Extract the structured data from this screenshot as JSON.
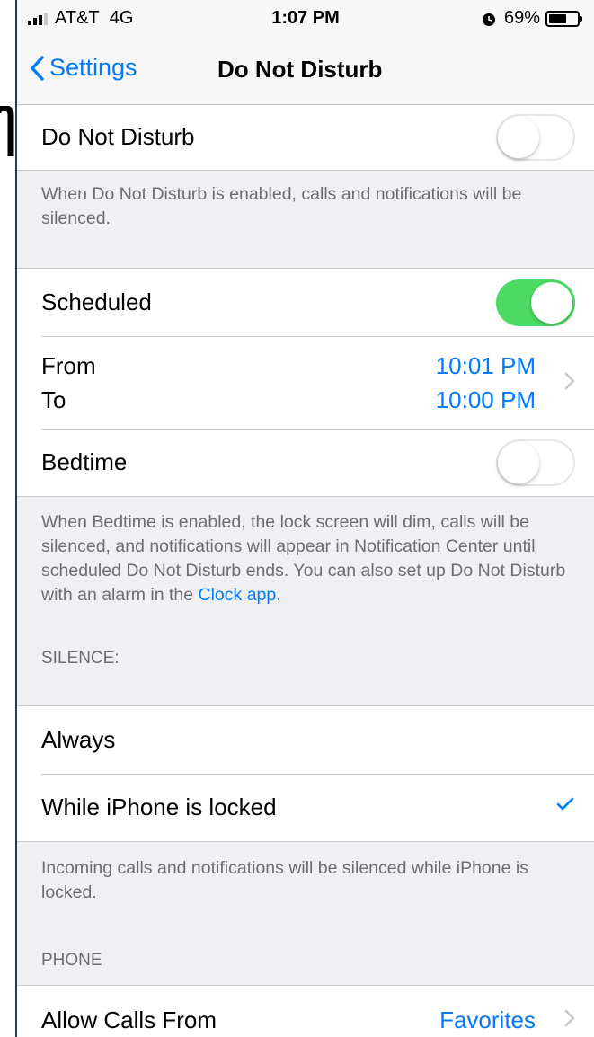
{
  "status": {
    "carrier": "AT&T",
    "network": "4G",
    "time": "1:07 PM",
    "battery": "69%",
    "battery_level": 0.69,
    "alarm_icon": "alarm-clock-icon"
  },
  "nav": {
    "back_label": "Settings",
    "title": "Do Not Disturb"
  },
  "dnd": {
    "label": "Do Not Disturb",
    "enabled": false,
    "footer": "When Do Not Disturb is enabled, calls and notifications will be silenced."
  },
  "scheduled": {
    "label": "Scheduled",
    "enabled": true,
    "from_label": "From",
    "from_value": "10:01 PM",
    "to_label": "To",
    "to_value": "10:00 PM",
    "bedtime_label": "Bedtime",
    "bedtime_enabled": false,
    "footer": "When Bedtime is enabled, the lock screen will dim, calls will be silenced, and notifications will appear in Notification Center until scheduled Do Not Disturb ends. You can also set up Do Not Disturb with an alarm in the",
    "footer_link": "Clock app."
  },
  "silence": {
    "header": "SILENCE:",
    "options": [
      {
        "label": "Always",
        "selected": false
      },
      {
        "label": "While iPhone is locked",
        "selected": true
      }
    ],
    "footer": "Incoming calls and notifications will be silenced while iPhone is locked."
  },
  "phone": {
    "header": "PHONE",
    "allow_calls_label": "Allow Calls From",
    "allow_calls_value": "Favorites"
  },
  "colors": {
    "accent": "#007aff",
    "toggle_on": "#4cd964",
    "background": "#efeff4"
  }
}
